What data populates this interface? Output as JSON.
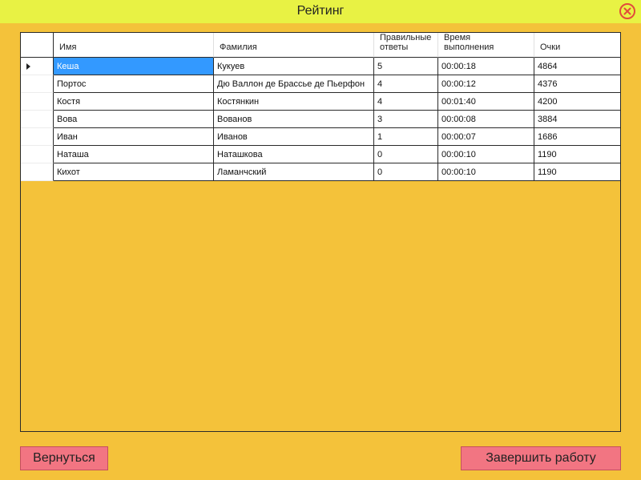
{
  "window": {
    "title": "Рейтинг"
  },
  "grid": {
    "columns": [
      {
        "label": "Имя"
      },
      {
        "label": "Фамилия"
      },
      {
        "label": "Правильные ответы"
      },
      {
        "label": "Время выполнения"
      },
      {
        "label": "Очки"
      }
    ],
    "selected_row": 0,
    "rows": [
      {
        "name": "Кеша",
        "surname": "Кукуев",
        "correct": "5",
        "time": "00:00:18",
        "score": "4864"
      },
      {
        "name": "Портос",
        "surname": "Дю Валлон де Брассье де Пьерфон",
        "correct": "4",
        "time": "00:00:12",
        "score": "4376"
      },
      {
        "name": "Костя",
        "surname": "Костянкин",
        "correct": "4",
        "time": "00:01:40",
        "score": "4200"
      },
      {
        "name": "Вова",
        "surname": "Вованов",
        "correct": "3",
        "time": "00:00:08",
        "score": "3884"
      },
      {
        "name": "Иван",
        "surname": "Иванов",
        "correct": "1",
        "time": "00:00:07",
        "score": "1686"
      },
      {
        "name": "Наташа",
        "surname": "Наташкова",
        "correct": "0",
        "time": "00:00:10",
        "score": "1190"
      },
      {
        "name": "Кихот",
        "surname": "Ламанчский",
        "correct": "0",
        "time": "00:00:10",
        "score": "1190"
      }
    ]
  },
  "buttons": {
    "back_label": "Вернуться",
    "finish_label": "Завершить работу"
  },
  "colors": {
    "background": "#F4C23A",
    "titlebar": "#E8F244",
    "button": "#F27582",
    "selection": "#3399FF",
    "close": "#E24B3B"
  },
  "icons": {
    "close": "close-circle-icon",
    "row_indicator": "triangle-right-icon"
  }
}
